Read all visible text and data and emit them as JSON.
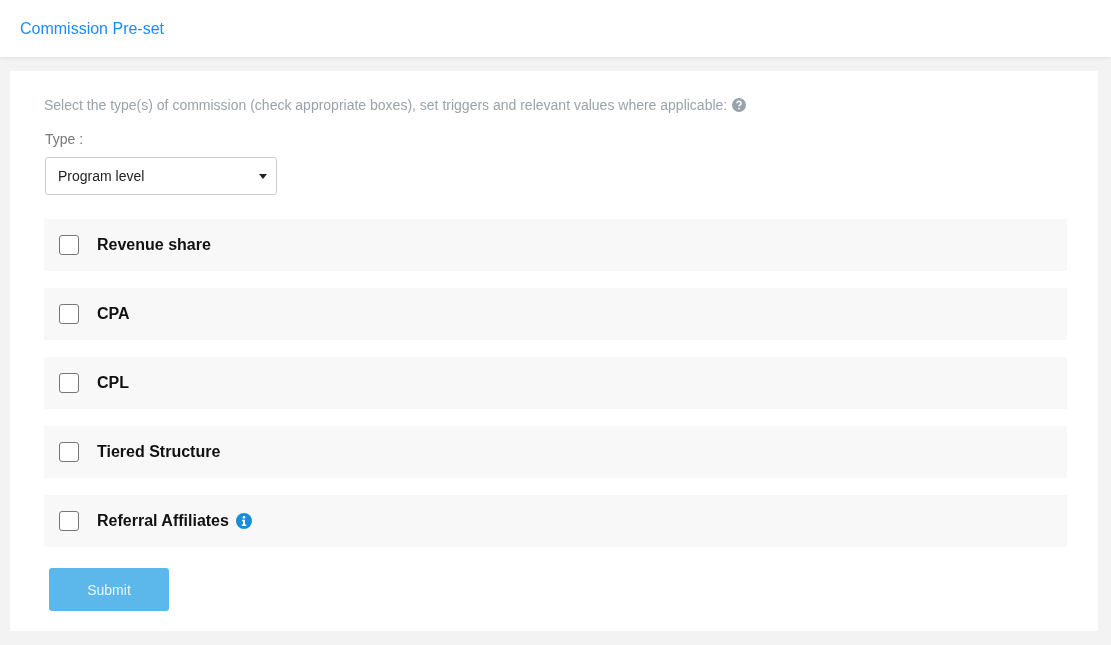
{
  "header": {
    "title": "Commission Pre-set"
  },
  "form": {
    "instructions": "Select the type(s) of commission (check appropriate boxes), set triggers and relevant values where applicable:",
    "type_label": "Type :",
    "type_select": {
      "value": "Program level"
    },
    "options": [
      {
        "label": "Revenue share",
        "checked": false,
        "info": false
      },
      {
        "label": "CPA",
        "checked": false,
        "info": false
      },
      {
        "label": "CPL",
        "checked": false,
        "info": false
      },
      {
        "label": "Tiered Structure",
        "checked": false,
        "info": false
      },
      {
        "label": "Referral Affiliates",
        "checked": false,
        "info": true
      }
    ],
    "submit": {
      "label": "Submit",
      "disabled": true
    }
  }
}
